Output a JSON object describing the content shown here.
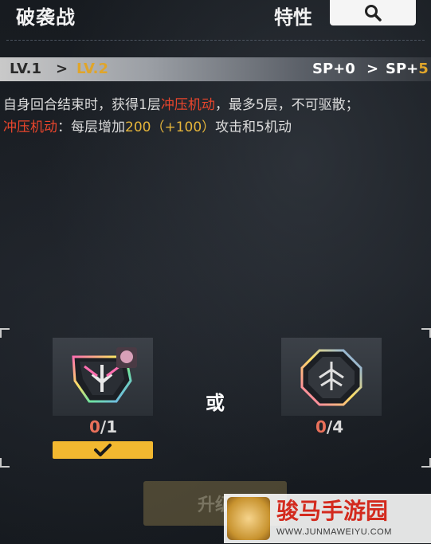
{
  "header": {
    "title": "破袭战",
    "trait_label": "特性"
  },
  "level": {
    "current": "LV.1",
    "arrow": ">",
    "next": "LV.2",
    "sp_current": "SP+0",
    "sp_arrow": ">",
    "sp_next_prefix": "SP+",
    "sp_next_value": "5"
  },
  "description": {
    "line1_a": "自身回合结束时，获得1层",
    "line1_keyword": "冲压机动",
    "line1_b": "，最多5层，不可驱散；",
    "line2_keyword": "冲压机动",
    "line2_a": "：每层增加",
    "line2_value": "200（+100）",
    "line2_b": "攻击和5机动"
  },
  "materials": {
    "or_label": "或",
    "item1": {
      "have": "0",
      "need": "/1"
    },
    "item2": {
      "have": "0",
      "need": "/4"
    }
  },
  "upgrade_button": {
    "label": "升级"
  },
  "watermark": {
    "title": "骏马手游园",
    "url": "WWW.JUNMAWEIYU.COM"
  },
  "colors": {
    "accent_gold": "#e0a52a",
    "keyword_red": "#e8452c",
    "check_yellow": "#f2b830"
  }
}
